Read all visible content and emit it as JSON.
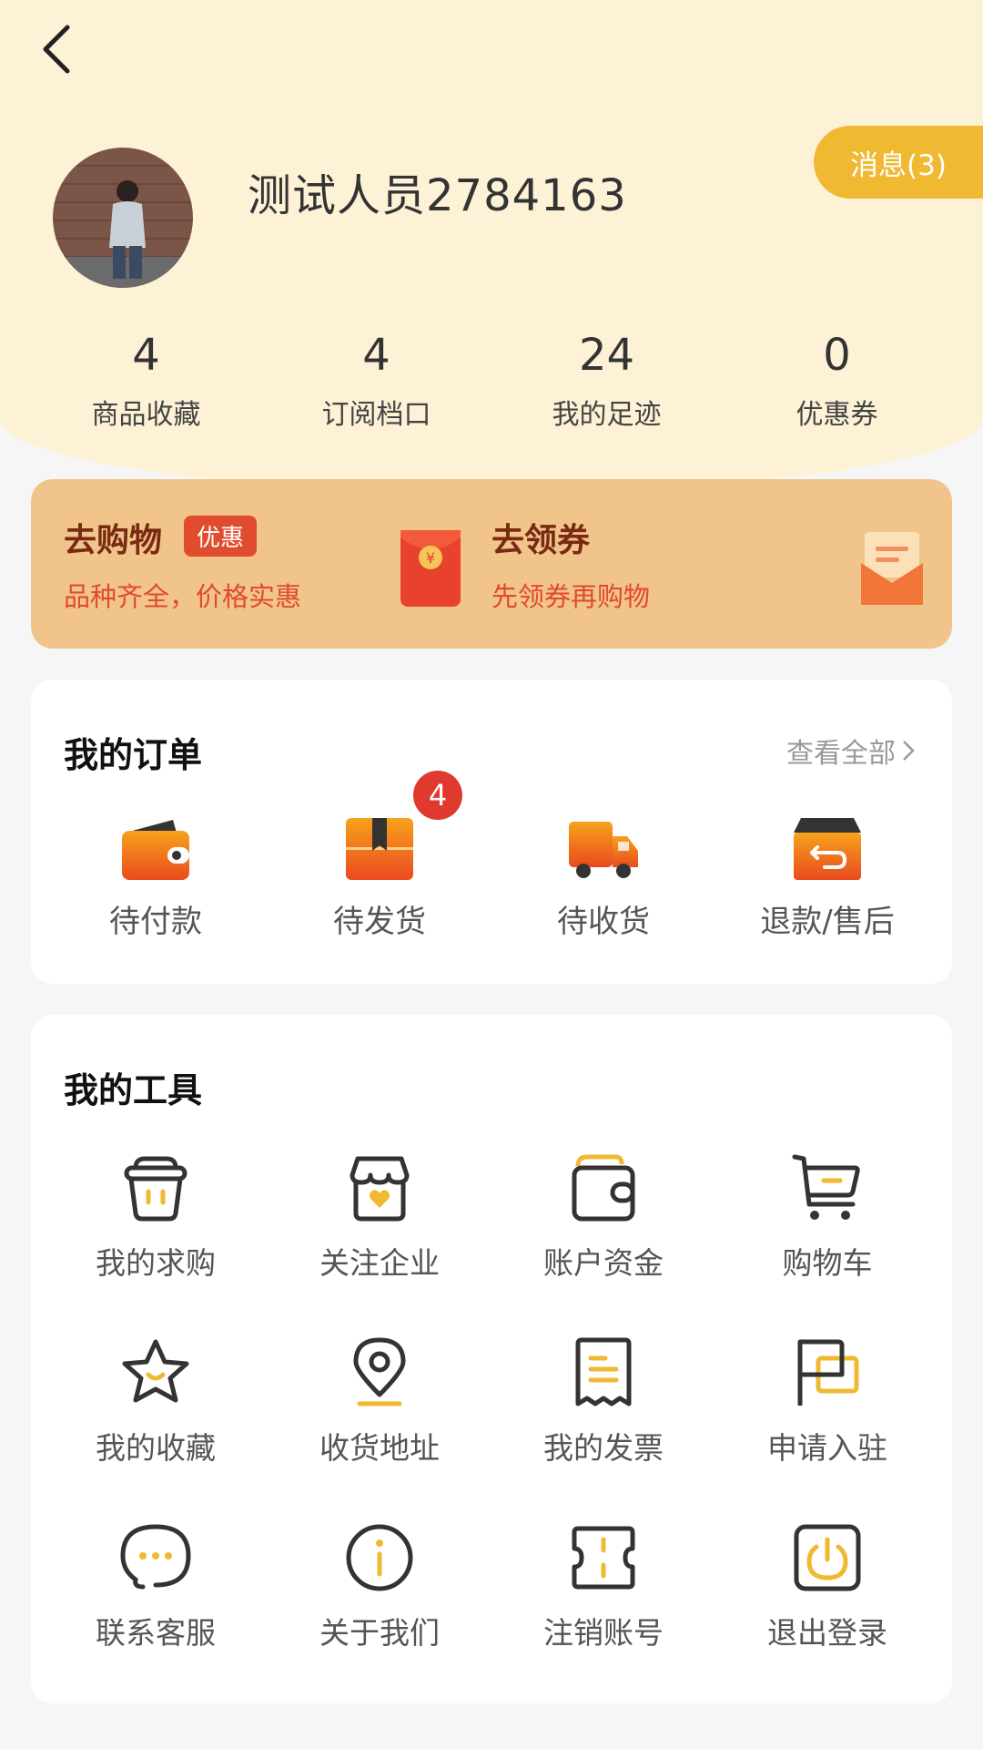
{
  "header": {
    "username": "测试人员2784163",
    "message_label": "消息(3)"
  },
  "stats": [
    {
      "value": "4",
      "label": "商品收藏"
    },
    {
      "value": "4",
      "label": "订阅档口"
    },
    {
      "value": "24",
      "label": "我的足迹"
    },
    {
      "value": "0",
      "label": "优惠券"
    }
  ],
  "promo": {
    "shop_title": "去购物",
    "shop_tag": "优惠",
    "shop_subtitle": "品种齐全，价格实惠",
    "coupon_title": "去领券",
    "coupon_subtitle": "先领券再购物",
    "envelope_symbol": "¥"
  },
  "orders": {
    "title": "我的订单",
    "view_all": "查看全部",
    "items": [
      {
        "label": "待付款",
        "icon": "wallet-icon"
      },
      {
        "label": "待发货",
        "icon": "box-icon",
        "badge": "4"
      },
      {
        "label": "待收货",
        "icon": "truck-icon"
      },
      {
        "label": "退款/售后",
        "icon": "return-box-icon"
      }
    ]
  },
  "tools": {
    "title": "我的工具",
    "items": [
      {
        "label": "我的求购",
        "icon": "basket-icon"
      },
      {
        "label": "关注企业",
        "icon": "store-heart-icon"
      },
      {
        "label": "账户资金",
        "icon": "wallet-outline-icon"
      },
      {
        "label": "购物车",
        "icon": "cart-icon"
      },
      {
        "label": "我的收藏",
        "icon": "star-icon"
      },
      {
        "label": "收货地址",
        "icon": "location-pin-icon"
      },
      {
        "label": "我的发票",
        "icon": "invoice-icon"
      },
      {
        "label": "申请入驻",
        "icon": "flag-icon"
      },
      {
        "label": "联系客服",
        "icon": "chat-bubble-icon"
      },
      {
        "label": "关于我们",
        "icon": "info-icon"
      },
      {
        "label": "注销账号",
        "icon": "ticket-icon"
      },
      {
        "label": "退出登录",
        "icon": "power-icon"
      }
    ]
  },
  "colors": {
    "header_bg": "#fdf2d6",
    "accent_yellow": "#efb932",
    "promo_bg": "#f1c48b",
    "badge_red": "#e03a2e",
    "icon_orange": "#ee5a24"
  }
}
